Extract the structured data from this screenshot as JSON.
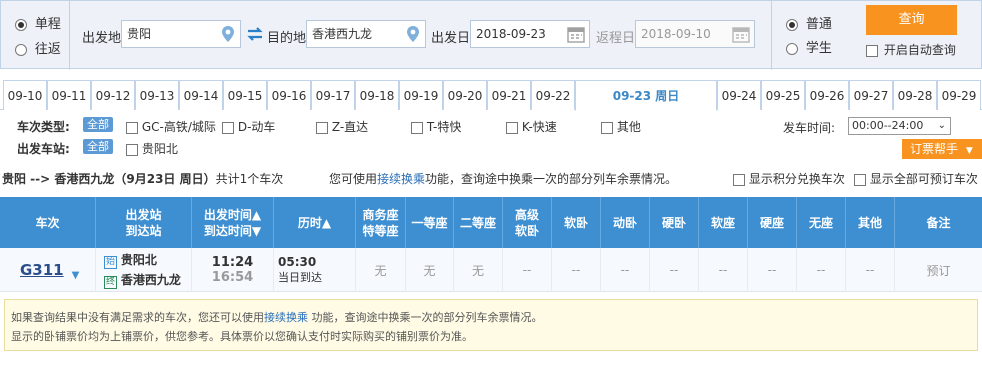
{
  "search": {
    "trip_types": [
      {
        "label": "单程",
        "checked": true
      },
      {
        "label": "往返",
        "checked": false
      }
    ],
    "from_label": "出发地",
    "from_value": "贵阳",
    "to_label": "目的地",
    "to_value": "香港西九龙",
    "depart_label": "出发日",
    "depart_value": "2018-09-23",
    "return_label": "返程日",
    "return_value": "2018-09-10",
    "passenger_types": [
      {
        "label": "普通",
        "checked": true
      },
      {
        "label": "学生",
        "checked": false
      }
    ],
    "query_button": "查询",
    "auto_query_label": "开启自动查询"
  },
  "dates": [
    "09-10",
    "09-11",
    "09-12",
    "09-13",
    "09-14",
    "09-15",
    "09-16",
    "09-17",
    "09-18",
    "09-19",
    "09-20",
    "09-21",
    "09-22",
    "09-23 周日",
    "09-24",
    "09-25",
    "09-26",
    "09-27",
    "09-28",
    "09-29"
  ],
  "active_date_index": 13,
  "filters": {
    "train_type_label": "车次类型:",
    "depart_station_label": "出发车站:",
    "all_label": "全部",
    "train_types": [
      "GC-高铁/城际",
      "D-动车",
      "Z-直达",
      "T-特快",
      "K-快速",
      "其他"
    ],
    "stations": [
      "贵阳北"
    ],
    "depart_time_label": "发车时间:",
    "depart_time_value": "00:00--24:00",
    "help_button": "订票帮手"
  },
  "route_bar": {
    "route": "贵阳 --> 香港西九龙（9月23日  周日）",
    "count_text": "共计1个车次",
    "hint_prefix": "您可使用",
    "hint_link": "接续换乘",
    "hint_suffix": "功能，查询途中换乘一次的部分列车余票情况。",
    "points_exchange_label": "显示积分兑换车次",
    "show_all_label": "显示全部可预订车次"
  },
  "table": {
    "headers": [
      [
        "车次"
      ],
      [
        "出发站",
        "到达站"
      ],
      [
        "出发时间▲",
        "到达时间▼"
      ],
      [
        "历时▲"
      ],
      [
        "商务座",
        "特等座"
      ],
      [
        "一等座"
      ],
      [
        "二等座"
      ],
      [
        "高级",
        "软卧"
      ],
      [
        "软卧"
      ],
      [
        "动卧"
      ],
      [
        "硬卧"
      ],
      [
        "软座"
      ],
      [
        "硬座"
      ],
      [
        "无座"
      ],
      [
        "其他"
      ],
      [
        "备注"
      ]
    ],
    "rows": [
      {
        "train_no": "G311",
        "from_station": "贵阳北",
        "from_badge": "始",
        "to_station": "香港西九龙",
        "to_badge": "终",
        "depart_time": "11:24",
        "arrive_time": "16:54",
        "duration": "05:30",
        "arrive_day": "当日到达",
        "seats": [
          "无",
          "无",
          "无",
          "--",
          "--",
          "--",
          "--",
          "--",
          "--",
          "--",
          "--"
        ],
        "action": "预订"
      }
    ]
  },
  "notice": {
    "line1_prefix": "如果查询结果中没有满足需求的车次，您还可以使用",
    "line1_link": "接续换乘",
    "line1_suffix": " 功能，查询途中换乘一次的部分列车余票情况。",
    "line2": "显示的卧铺票价均为上铺票价，供您参考。具体票价以您确认支付时实际购买的铺别票价为准。"
  },
  "colors": {
    "header_blue": "#3d8fd1",
    "orange": "#f7931e",
    "link": "#2a6fb8",
    "train_green": "#2e8b57"
  }
}
